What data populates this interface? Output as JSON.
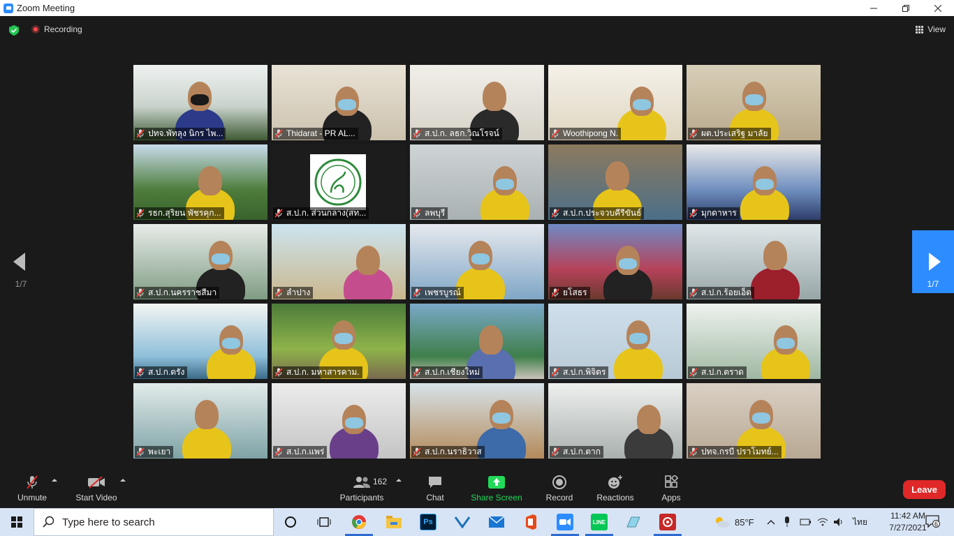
{
  "window": {
    "title": "Zoom Meeting",
    "controls": [
      "minimize-icon",
      "restore-icon",
      "close-icon"
    ]
  },
  "topbar": {
    "recording_label": "Recording",
    "view_label": "View"
  },
  "pagination": {
    "prev_label": "1/7",
    "next_label": "1/7"
  },
  "tiles": [
    "ปทจ.พัทลุง นิกร ไพ...",
    "Thidarat - PR AL...",
    "ส.ป.ก. ลธก.วิณโรจน์",
    "Woothipong N.",
    "ผต.ประเสริฐ มาลัย",
    "รธก.สุริยน พัชรคุก...",
    "ส.ป.ก. ส่วนกลาง(สท...",
    "ลพบุรี",
    "ส.ป.ก.ประจวบคีรีขันธ์",
    "มุกดาหาร",
    "ส.ป.ก.นครราชสีมา",
    "ลำปาง",
    "เพชรบูรณ์",
    "ยโสธร",
    "ส.ป.ก.ร้อยเอ็ด",
    "ส.ป.ก.ตรัง",
    "ส.ป.ก. มหาสารคาม.",
    "ส.ป.ก.เชียงใหม่",
    "ส.ป.ก.พิจิตร",
    "ส.ป.ก.ตราด",
    "พะเยา",
    "ส.ป.ก.แพร่",
    "ส.ป.ก.นราธิวาส",
    "ส.ป.ก.ตาก",
    "ปทจ.กรบี ปราโมทย์..."
  ],
  "active_speaker": "ส.ป.ก.ตาก",
  "toolbar": {
    "unmute": "Unmute",
    "start_video": "Start Video",
    "participants": "Participants",
    "participant_count": "162",
    "chat": "Chat",
    "share_screen": "Share Screen",
    "record": "Record",
    "reactions": "Reactions",
    "apps": "Apps",
    "leave": "Leave"
  },
  "taskbar": {
    "search_placeholder": "Type here to search",
    "weather": "85°F",
    "language": "ไทย",
    "time": "11:42 AM",
    "date": "7/27/2021",
    "notifications": "6",
    "apps": [
      "cortana-icon",
      "task-view-icon",
      "chrome-icon",
      "file-explorer-icon",
      "photoshop-icon",
      "v-app-icon",
      "mail-icon",
      "office-icon",
      "zoom-icon",
      "line-icon",
      "app-icon",
      "red-app-icon"
    ]
  },
  "colors": {
    "accent": "#2d8cff",
    "leave": "#e02828",
    "share_green": "#23d959",
    "active_border": "#d9e85a"
  }
}
